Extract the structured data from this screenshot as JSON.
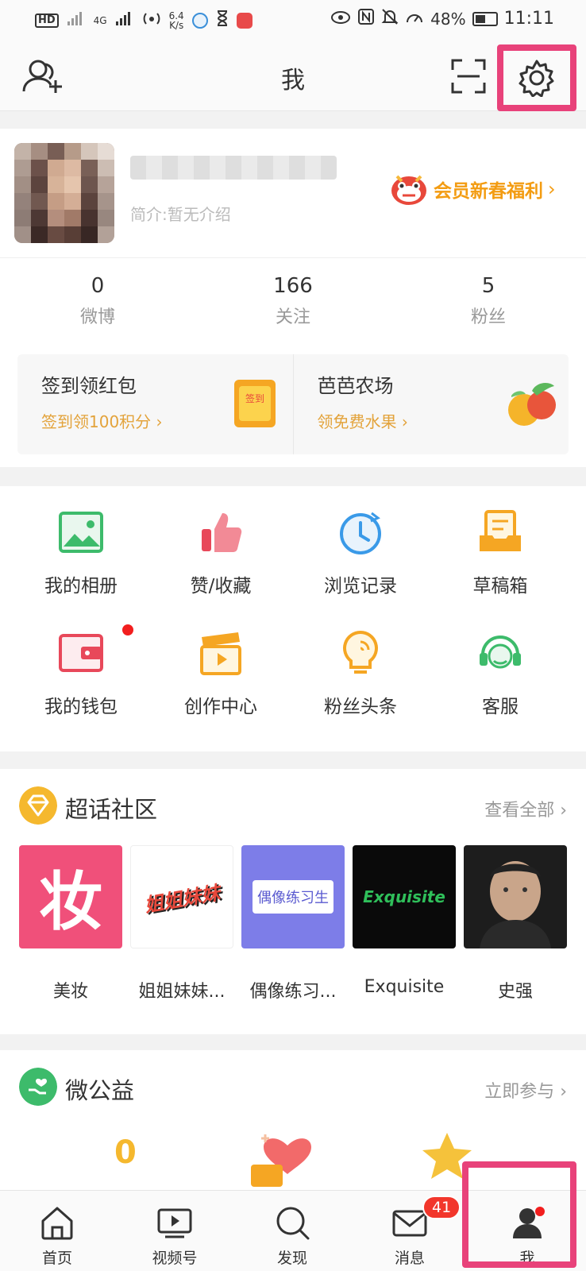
{
  "status_bar": {
    "hd": "HD",
    "network": "4G",
    "speed_value": "6.4",
    "speed_unit": "K/s",
    "battery": "48%",
    "time": "11:11"
  },
  "header": {
    "title": "我"
  },
  "profile": {
    "bio": "简介:暂无介绍",
    "vip_label": "会员新春福利",
    "stats": [
      {
        "value": "0",
        "label": "微博"
      },
      {
        "value": "166",
        "label": "关注"
      },
      {
        "value": "5",
        "label": "粉丝"
      }
    ]
  },
  "tasks": [
    {
      "title": "签到领红包",
      "sub": "签到领100积分 ›",
      "badge": "签到"
    },
    {
      "title": "芭芭农场",
      "sub": "领免费水果 ›"
    }
  ],
  "shortcuts": [
    {
      "label": "我的相册",
      "icon": "album-icon"
    },
    {
      "label": "赞/收藏",
      "icon": "thumbs-up-icon"
    },
    {
      "label": "浏览记录",
      "icon": "history-clock-icon"
    },
    {
      "label": "草稿箱",
      "icon": "drafts-icon"
    },
    {
      "label": "我的钱包",
      "icon": "wallet-icon"
    },
    {
      "label": "创作中心",
      "icon": "creator-center-icon"
    },
    {
      "label": "粉丝头条",
      "icon": "fans-headline-icon"
    },
    {
      "label": "客服",
      "icon": "customer-service-icon"
    }
  ],
  "super_topic": {
    "title": "超话社区",
    "more": "查看全部 ›",
    "items": [
      {
        "label": "美妆",
        "img_text": "妆"
      },
      {
        "label": "姐姐妹妹...",
        "img_text": "姐姐妹妹"
      },
      {
        "label": "偶像练习...",
        "img_text": "偶像练习生"
      },
      {
        "label": "Exquisite",
        "img_text": "Exquisite"
      },
      {
        "label": "史强"
      }
    ]
  },
  "charity": {
    "title": "微公益",
    "more": "立即参与 ›",
    "count": "0"
  },
  "tabbar": {
    "items": [
      {
        "label": "首页",
        "icon": "home-icon"
      },
      {
        "label": "视频号",
        "icon": "video-icon"
      },
      {
        "label": "发现",
        "icon": "discover-icon"
      },
      {
        "label": "消息",
        "icon": "message-icon",
        "badge": "41"
      },
      {
        "label": "我",
        "icon": "profile-icon"
      }
    ]
  },
  "colors": {
    "accent": "#f39c12",
    "highlight_frame": "#e8427a",
    "badge_red": "#f2362b"
  }
}
